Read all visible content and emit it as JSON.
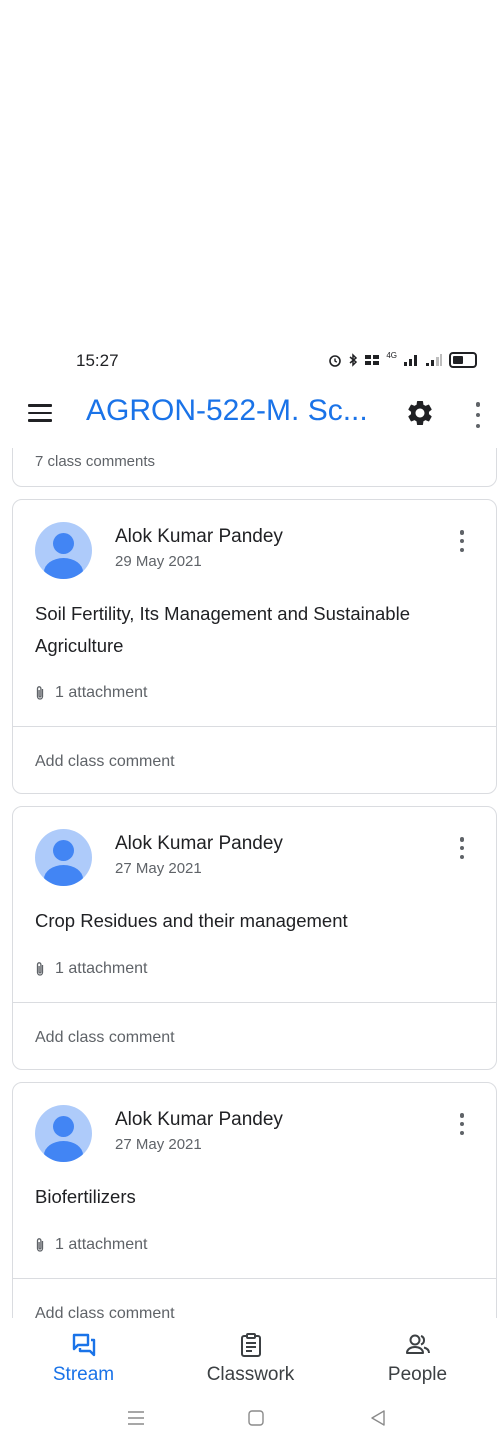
{
  "status_bar": {
    "time": "15:27",
    "network": "4G"
  },
  "app_bar": {
    "title": "AGRON-522-M. Sc..."
  },
  "previous_card": {
    "text": "7 class comments"
  },
  "posts": [
    {
      "author": "Alok Kumar Pandey",
      "date": "29 May 2021",
      "title": "Soil Fertility, Its Management and Sustainable Agriculture",
      "attachments": "1 attachment",
      "comment_placeholder": "Add class comment"
    },
    {
      "author": "Alok Kumar Pandey",
      "date": "27 May 2021",
      "title": "Crop Residues and their management",
      "attachments": "1 attachment",
      "comment_placeholder": "Add class comment"
    },
    {
      "author": "Alok Kumar Pandey",
      "date": "27 May 2021",
      "title": "Biofertilizers",
      "attachments": "1 attachment",
      "comment_placeholder": "Add class comment"
    }
  ],
  "bottom_nav": [
    {
      "label": "Stream",
      "icon": "stream-icon",
      "active": true
    },
    {
      "label": "Classwork",
      "icon": "classwork-icon",
      "active": false
    },
    {
      "label": "People",
      "icon": "people-icon",
      "active": false
    }
  ],
  "colors": {
    "accent": "#1a73e8",
    "avatar_bg": "#aecbfa",
    "avatar_fg": "#4285f4"
  }
}
